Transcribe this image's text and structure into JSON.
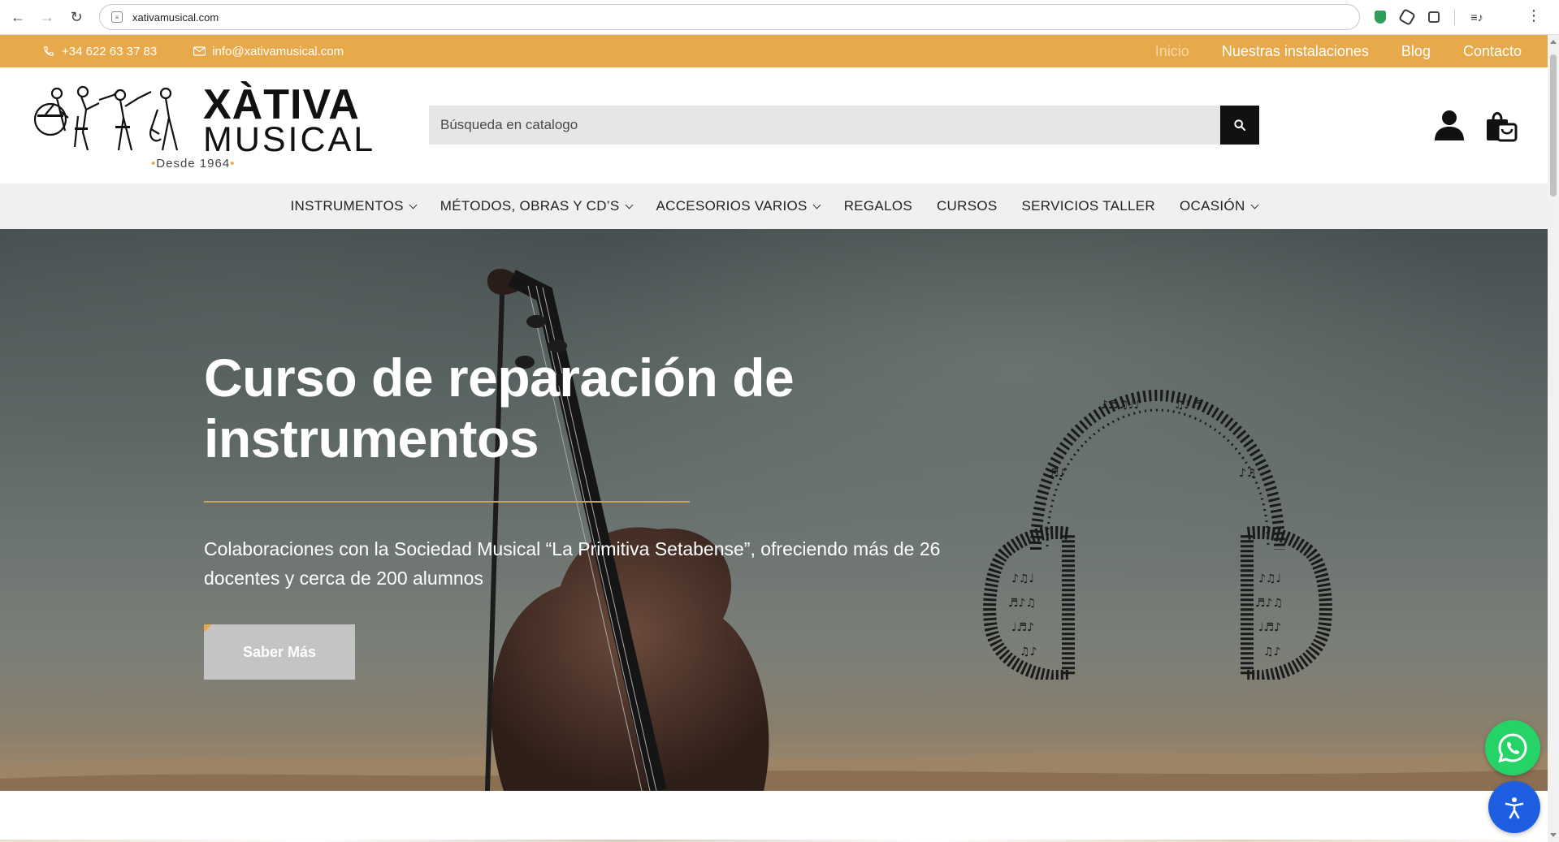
{
  "browser": {
    "url": "xativamusical.com",
    "back_icon": "←",
    "forward_icon": "→",
    "reload_icon": "↻",
    "menu_icon": "⋮"
  },
  "topbar": {
    "phone": "+34 622 63 37 83",
    "email": "info@xativamusical.com",
    "links": [
      "Inicio",
      "Nuestras instalaciones",
      "Blog",
      "Contacto"
    ],
    "background": "#e8a94a"
  },
  "header": {
    "logo_line1": "XÀTIVA",
    "logo_line2": "MUSICAL",
    "logo_since": "Desde 1964",
    "search_placeholder": "Búsqueda en catalogo"
  },
  "nav": {
    "items": [
      {
        "label": "INSTRUMENTOS",
        "dropdown": true
      },
      {
        "label": "MÉTODOS, OBRAS Y CD’S",
        "dropdown": true
      },
      {
        "label": "ACCESORIOS VARIOS",
        "dropdown": true
      },
      {
        "label": "REGALOS",
        "dropdown": false
      },
      {
        "label": "CURSOS",
        "dropdown": false
      },
      {
        "label": "SERVICIOS TALLER",
        "dropdown": false
      },
      {
        "label": "OCASIÓN",
        "dropdown": true
      }
    ]
  },
  "hero": {
    "title": "Curso de reparación de instrumentos",
    "subtitle": "Colaboraciones con la Sociedad Musical “La Primitiva Setabense”, ofreciendo más de 26 docentes y cerca de 200 alumnos",
    "button": "Saber Más",
    "accent_color": "#c9a058"
  },
  "floating": {
    "whatsapp_color": "#25d366",
    "accessibility_color": "#1d5fe0"
  }
}
